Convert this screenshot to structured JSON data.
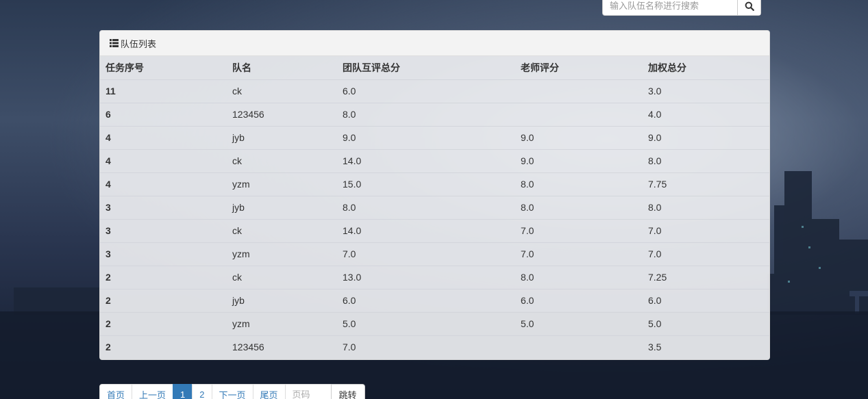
{
  "search": {
    "placeholder": "输入队伍名称进行搜索"
  },
  "panel": {
    "title": "队伍列表"
  },
  "table": {
    "headers": [
      "任务序号",
      "队名",
      "团队互评总分",
      "老师评分",
      "加权总分"
    ],
    "rows": [
      {
        "task": "11",
        "team": "ck",
        "peer": "6.0",
        "teacher": "",
        "weighted": "3.0"
      },
      {
        "task": "6",
        "team": "123456",
        "peer": "8.0",
        "teacher": "",
        "weighted": "4.0"
      },
      {
        "task": "4",
        "team": "jyb",
        "peer": "9.0",
        "teacher": "9.0",
        "weighted": "9.0"
      },
      {
        "task": "4",
        "team": "ck",
        "peer": "14.0",
        "teacher": "9.0",
        "weighted": "8.0"
      },
      {
        "task": "4",
        "team": "yzm",
        "peer": "15.0",
        "teacher": "8.0",
        "weighted": "7.75"
      },
      {
        "task": "3",
        "team": "jyb",
        "peer": "8.0",
        "teacher": "8.0",
        "weighted": "8.0"
      },
      {
        "task": "3",
        "team": "ck",
        "peer": "14.0",
        "teacher": "7.0",
        "weighted": "7.0"
      },
      {
        "task": "3",
        "team": "yzm",
        "peer": "7.0",
        "teacher": "7.0",
        "weighted": "7.0"
      },
      {
        "task": "2",
        "team": "ck",
        "peer": "13.0",
        "teacher": "8.0",
        "weighted": "7.25"
      },
      {
        "task": "2",
        "team": "jyb",
        "peer": "6.0",
        "teacher": "6.0",
        "weighted": "6.0"
      },
      {
        "task": "2",
        "team": "yzm",
        "peer": "5.0",
        "teacher": "5.0",
        "weighted": "5.0"
      },
      {
        "task": "2",
        "team": "123456",
        "peer": "7.0",
        "teacher": "",
        "weighted": "3.5"
      }
    ]
  },
  "pagination": {
    "first": "首页",
    "prev": "上一页",
    "pages": [
      "1",
      "2"
    ],
    "active_page": "1",
    "next": "下一页",
    "last": "尾页",
    "page_input_placeholder": "页码",
    "jump": "跳转"
  },
  "colors": {
    "accent": "#337ab7"
  },
  "icons": {
    "search": "search-icon",
    "list": "list-icon"
  }
}
